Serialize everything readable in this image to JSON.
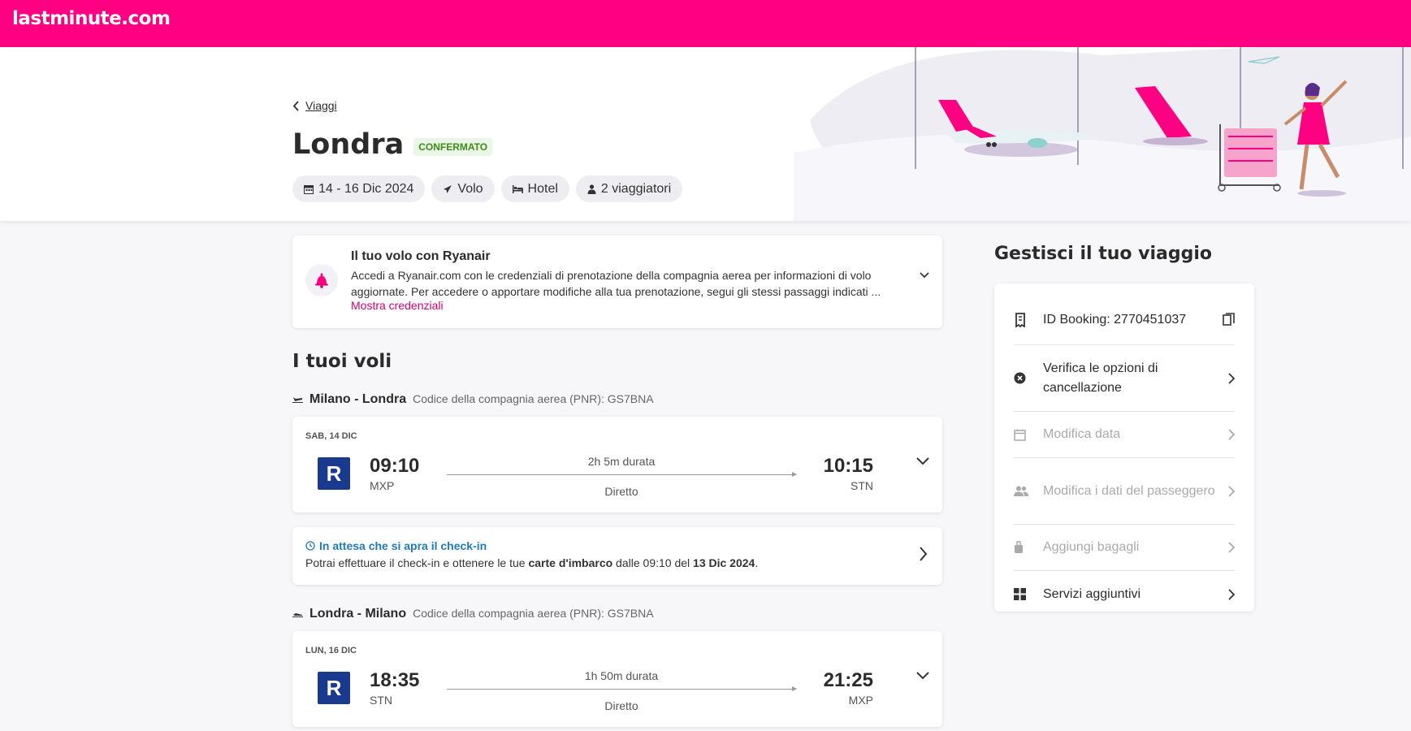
{
  "header": {
    "logo": "lastminute.com"
  },
  "trip": {
    "back_label": "Viaggi",
    "title": "Londra",
    "status": "CONFERMATO",
    "chips": {
      "dates": "14 - 16 Dic 2024",
      "flight": "Volo",
      "hotel": "Hotel",
      "travelers": "2 viaggiatori"
    }
  },
  "notice": {
    "title": "Il tuo volo con Ryanair",
    "text": "Accedi a Ryanair.com con le credenziali di prenotazione della compagnia aerea per informazioni di volo aggiornate. Per accedere o apportare modifiche alla tua prenotazione, segui gli stessi passaggi indicati ...",
    "link": "Mostra credenziali"
  },
  "flights_section": {
    "title": "I tuoi voli"
  },
  "outbound": {
    "route": "Milano - Londra",
    "pnr": "Codice della compagnia aerea (PNR): GS7BNA",
    "date": "SAB, 14 DIC",
    "airline_letter": "R",
    "dep_time": "09:10",
    "dep_code": "MXP",
    "duration": "2h 5m durata",
    "stops": "Diretto",
    "arr_time": "10:15",
    "arr_code": "STN"
  },
  "checkin": {
    "title": "In attesa che si apra il check-in",
    "text_1": "Potrai effettuare il check-in e ottenere le tue ",
    "text_bold_1": "carte d'imbarco",
    "text_2": " dalle 09:10 del ",
    "text_bold_2": "13 Dic 2024",
    "text_3": "."
  },
  "return": {
    "route": "Londra - Milano",
    "pnr": "Codice della compagnia aerea (PNR): GS7BNA",
    "date": "LUN, 16 DIC",
    "airline_letter": "R",
    "dep_time": "18:35",
    "dep_code": "STN",
    "duration": "1h 50m durata",
    "stops": "Diretto",
    "arr_time": "21:25",
    "arr_code": "MXP"
  },
  "manage": {
    "title": "Gestisci il tuo viaggio",
    "items": [
      {
        "label": "ID Booking: 2770451037",
        "icon": "ticket-icon",
        "end": "copy-icon"
      },
      {
        "label": "Verifica le opzioni di cancellazione",
        "icon": "cancel-circle-icon",
        "end": "chevron-right-icon"
      },
      {
        "label": "Modifica data",
        "icon": "calendar-icon",
        "end": "chevron-right-icon",
        "disabled": true
      },
      {
        "label": "Modifica i dati del passeggero",
        "icon": "people-icon",
        "end": "chevron-right-icon",
        "disabled": true
      },
      {
        "label": "Aggiungi bagagli",
        "icon": "luggage-icon",
        "end": "chevron-right-icon",
        "disabled": true
      },
      {
        "label": "Servizi aggiuntivi",
        "icon": "grid-icon",
        "end": "chevron-right-icon"
      }
    ]
  },
  "colors": {
    "brand": "#ff0082",
    "confirmed": "#3d8b18",
    "info": "#1f7bb8",
    "airline": "#1a3a8f"
  }
}
